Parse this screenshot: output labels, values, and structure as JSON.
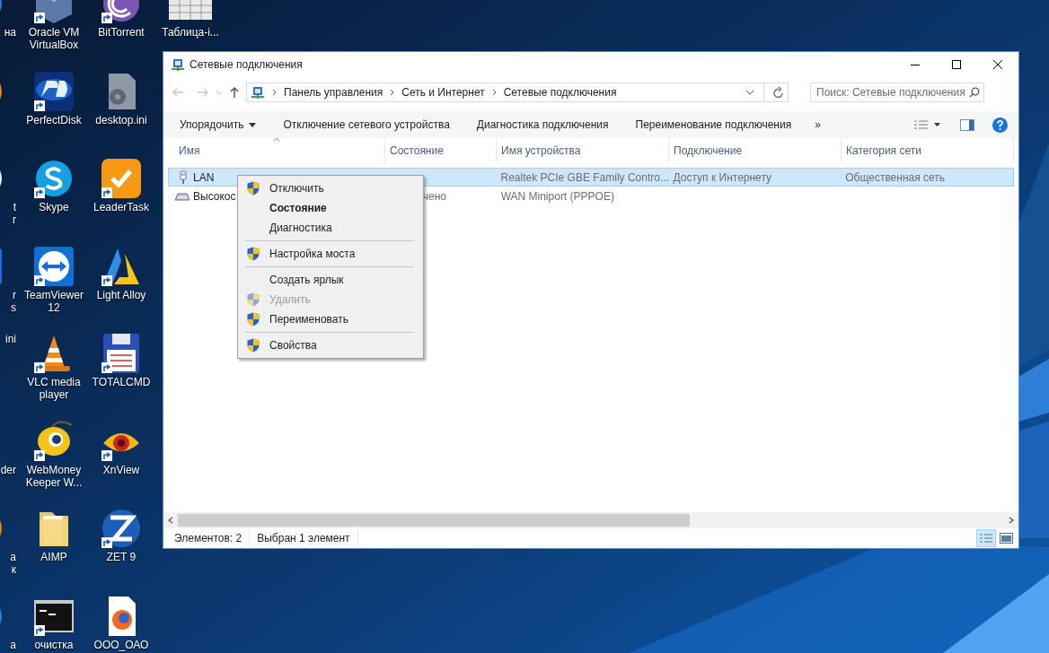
{
  "desktop": {
    "columns": [
      {
        "icons": [
          {
            "label": "на",
            "kind": "globe"
          },
          {
            "kind": "orange-disc"
          },
          {
            "label": "t\nr",
            "kind": "white-disc"
          },
          {
            "label": "r\ns",
            "kind": "blue-tile"
          },
          {
            "label": "ini"
          },
          {
            "label": "der",
            "kind": "orange-box"
          },
          {
            "label": "а\nк",
            "kind": "orange-disc"
          },
          {
            "label": "а",
            "kind": "globe"
          }
        ]
      },
      {
        "icons": [
          {
            "label": "Oracle VM VirtualBox",
            "kind": "virtualbox",
            "shortcut": true
          },
          {
            "label": "PerfectDisk",
            "kind": "perfectdisk",
            "shortcut": true
          },
          {
            "label": "Skype",
            "kind": "skype",
            "shortcut": true
          },
          {
            "label": "TeamViewer 12",
            "kind": "teamviewer",
            "shortcut": true
          },
          {
            "label": "VLC media player",
            "kind": "vlc",
            "shortcut": true
          },
          {
            "label": "WebMoney Keeper W...",
            "kind": "webmoney",
            "shortcut": true
          },
          {
            "label": "AIMP",
            "kind": "folder",
            "shortcut": false
          },
          {
            "label": "очистка",
            "kind": "console",
            "shortcut": true
          }
        ]
      },
      {
        "icons": [
          {
            "label": "BitTorrent",
            "kind": "bittorrent",
            "shortcut": true
          },
          {
            "label": "desktop.ini",
            "kind": "gear-file",
            "shortcut": false
          },
          {
            "label": "LeaderTask",
            "kind": "leadertask",
            "shortcut": true
          },
          {
            "label": "Light Alloy",
            "kind": "lightalloy",
            "shortcut": true
          },
          {
            "label": "TOTALCMD",
            "kind": "floppy",
            "shortcut": true
          },
          {
            "label": "XnView",
            "kind": "xnview",
            "shortcut": true
          },
          {
            "label": "ZET 9",
            "kind": "zet",
            "shortcut": true
          },
          {
            "label": "ООО_ОАО",
            "kind": "firefox-file",
            "shortcut": false
          }
        ]
      },
      {
        "icons": [
          {
            "label": "Таблица-i...",
            "kind": "spreadsheet",
            "shortcut": false
          }
        ]
      }
    ]
  },
  "window": {
    "title": "Сетевые подключения",
    "address": {
      "crumbs": [
        "Панель управления",
        "Сеть и Интернет",
        "Сетевые подключения"
      ]
    },
    "search": {
      "placeholder": "Поиск: Сетевые подключения"
    },
    "toolbar": {
      "items": [
        {
          "label": "Упорядочить",
          "dropdown": true
        },
        {
          "label": "Отключение сетевого устройства",
          "dropdown": false
        },
        {
          "label": "Диагностика подключения",
          "dropdown": false
        },
        {
          "label": "Переименование подключения",
          "dropdown": false
        }
      ],
      "overflow": "»"
    },
    "table": {
      "columns": [
        "Имя",
        "Состояние",
        "Имя устройства",
        "Подключение",
        "Категория сети"
      ],
      "rows": [
        {
          "kind": "ethernet",
          "selected": true,
          "cells": {
            "name": "LAN",
            "device": "Realtek PCIe GBE Family Contro...",
            "connection": "Доступ к Интернету",
            "category": "Общественная сеть"
          }
        },
        {
          "kind": "modem",
          "selected": false,
          "cells": {
            "name": "Высокос",
            "state": "чено",
            "device": "WAN Miniport (PPPOE)"
          }
        }
      ]
    },
    "status_bar": {
      "items": [
        "Элементов: 2",
        "Выбран 1 элемент"
      ],
      "details_view": true
    }
  },
  "context_menu": {
    "groups": [
      [
        {
          "label": "Отключить",
          "shield": true,
          "bold": false,
          "disabled": false
        },
        {
          "label": "Состояние",
          "shield": false,
          "bold": true,
          "disabled": false
        },
        {
          "label": "Диагностика",
          "shield": false,
          "bold": false,
          "disabled": false
        }
      ],
      [
        {
          "label": "Настройка моста",
          "shield": true,
          "bold": false,
          "disabled": false
        }
      ],
      [
        {
          "label": "Создать ярлык",
          "shield": false,
          "bold": false,
          "disabled": false
        },
        {
          "label": "Удалить",
          "shield": true,
          "bold": false,
          "disabled": true
        },
        {
          "label": "Переименовать",
          "shield": true,
          "bold": false,
          "disabled": false
        }
      ],
      [
        {
          "label": "Свойства",
          "shield": true,
          "bold": false,
          "disabled": false
        }
      ]
    ]
  }
}
